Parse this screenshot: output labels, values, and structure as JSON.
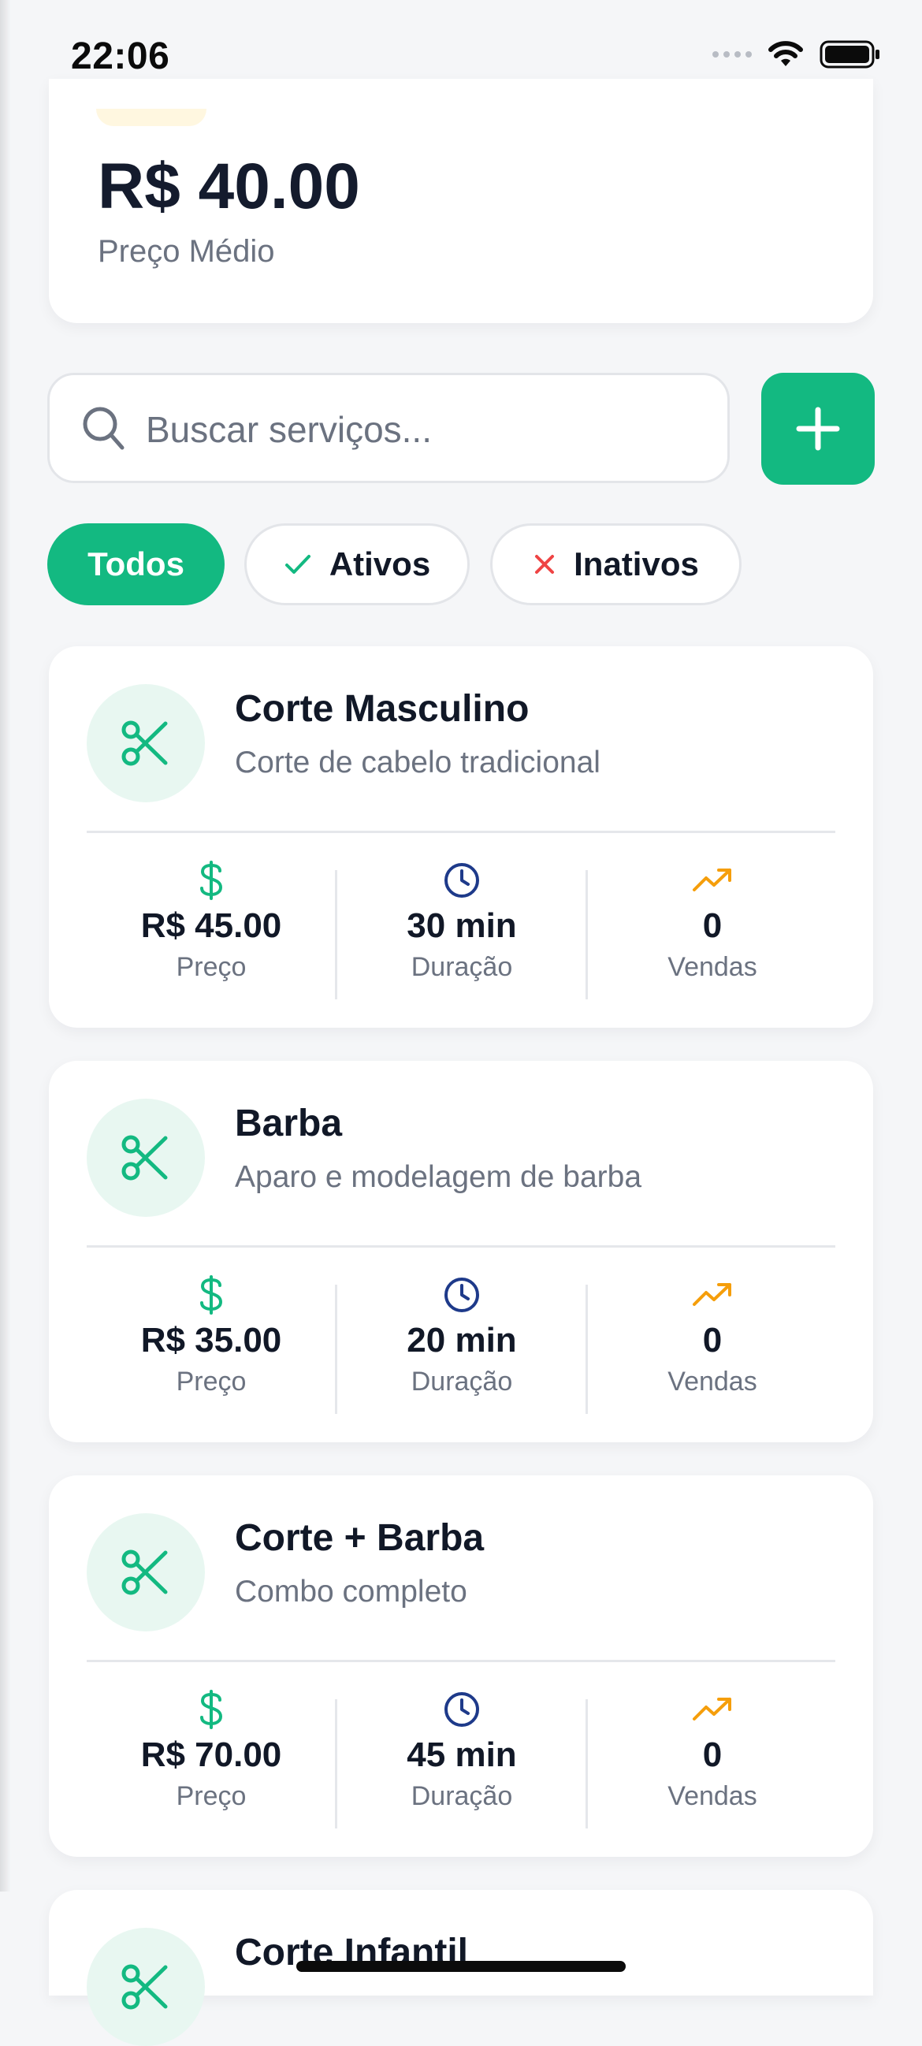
{
  "status_bar": {
    "time": "22:06"
  },
  "summary": {
    "value": "R$ 40.00",
    "label": "Preço Médio"
  },
  "search": {
    "placeholder": "Buscar serviços..."
  },
  "filters": [
    {
      "label": "Todos",
      "selected": true
    },
    {
      "label": "Ativos",
      "icon": "check-icon"
    },
    {
      "label": "Inativos",
      "icon": "x-icon"
    }
  ],
  "stat_labels": {
    "price": "Preço",
    "duration": "Duração",
    "sales": "Vendas"
  },
  "services": [
    {
      "name": "Corte Masculino",
      "description": "Corte de cabelo tradicional",
      "price": "R$ 45.00",
      "duration": "30 min",
      "sales": "0"
    },
    {
      "name": "Barba",
      "description": "Aparo e modelagem de barba",
      "price": "R$ 35.00",
      "duration": "20 min",
      "sales": "0"
    },
    {
      "name": "Corte + Barba",
      "description": "Combo completo",
      "price": "R$ 70.00",
      "duration": "45 min",
      "sales": "0"
    },
    {
      "name": "Corte Infantil"
    }
  ],
  "colors": {
    "accent": "#13b981",
    "clock": "#1e3a8a",
    "trend": "#f59e0b",
    "inactive": "#ef4444"
  }
}
